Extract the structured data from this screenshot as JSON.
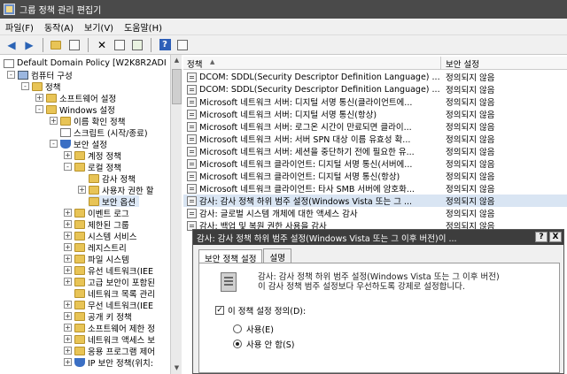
{
  "window": {
    "title": "그룹 정책 관리 편집기"
  },
  "menu": [
    "파일(F)",
    "동작(A)",
    "보기(V)",
    "도움말(H)"
  ],
  "tree": {
    "items": [
      {
        "label": "Default Domain Policy [W2K8R2ADI",
        "icon": "policy-icon",
        "expander": ""
      },
      {
        "label": "컴퓨터 구성",
        "icon": "computer-icon",
        "expander": "-"
      },
      {
        "label": "정책",
        "icon": "folder-icon",
        "expander": "-"
      },
      {
        "label": "소프트웨어 설정",
        "icon": "folder-icon",
        "expander": "+"
      },
      {
        "label": "Windows 설정",
        "icon": "folder-icon",
        "expander": "-"
      },
      {
        "label": "이름 확인 정책",
        "icon": "folder-icon",
        "expander": "+"
      },
      {
        "label": "스크립트 (시작/종료)",
        "icon": "script-icon",
        "expander": ""
      },
      {
        "label": "보안 설정",
        "icon": "shield-icon",
        "expander": "-"
      },
      {
        "label": "계정 정책",
        "icon": "folder-icon",
        "expander": "+"
      },
      {
        "label": "로컬 정책",
        "icon": "folder-icon",
        "expander": "-"
      },
      {
        "label": "감사 정책",
        "icon": "folder-icon",
        "expander": ""
      },
      {
        "label": "사용자 권한 할",
        "icon": "folder-icon",
        "expander": "+"
      },
      {
        "label": "보안 옵션",
        "icon": "folder-icon",
        "expander": ""
      },
      {
        "label": "이벤트 로그",
        "icon": "folder-icon",
        "expander": "+"
      },
      {
        "label": "제한된 그룹",
        "icon": "folder-icon",
        "expander": "+"
      },
      {
        "label": "시스템 서비스",
        "icon": "folder-icon",
        "expander": "+"
      },
      {
        "label": "레지스트리",
        "icon": "folder-icon",
        "expander": "+"
      },
      {
        "label": "파일 시스템",
        "icon": "folder-icon",
        "expander": "+"
      },
      {
        "label": "유선 네트워크(IEE",
        "icon": "folder-icon",
        "expander": "+"
      },
      {
        "label": "고급 보안이 포함된",
        "icon": "folder-icon",
        "expander": "+"
      },
      {
        "label": "네트워크 목록 관리",
        "icon": "folder-icon",
        "expander": ""
      },
      {
        "label": "무선 네트워크(IEE",
        "icon": "folder-icon",
        "expander": "+"
      },
      {
        "label": "공개 키 정책",
        "icon": "folder-icon",
        "expander": "+"
      },
      {
        "label": "소프트웨어 제한 정",
        "icon": "folder-icon",
        "expander": "+"
      },
      {
        "label": "네트워크 액세스 보",
        "icon": "folder-icon",
        "expander": "+"
      },
      {
        "label": "응용 프로그램 제어",
        "icon": "folder-icon",
        "expander": "+"
      },
      {
        "label": "IP 보안 정책(위치:",
        "icon": "shield-icon",
        "expander": "+"
      }
    ]
  },
  "list": {
    "col_policy": "정책",
    "col_setting": "보안 설정",
    "rows": [
      {
        "name": "DCOM: SDDL(Security Descriptor Definition Language) ...",
        "setting": "정의되지 않음"
      },
      {
        "name": "DCOM: SDDL(Security Descriptor Definition Language) ...",
        "setting": "정의되지 않음"
      },
      {
        "name": "Microsoft 네트워크 서버: 디지털 서명 통신(클라이언트에...",
        "setting": "정의되지 않음"
      },
      {
        "name": "Microsoft 네트워크 서버: 디지털 서명 통신(항상)",
        "setting": "정의되지 않음"
      },
      {
        "name": "Microsoft 네트워크 서버: 로그온 시간이 만료되면 클라이...",
        "setting": "정의되지 않음"
      },
      {
        "name": "Microsoft 네트워크 서버: 서버 SPN 대상 이름 유효성 확...",
        "setting": "정의되지 않음"
      },
      {
        "name": "Microsoft 네트워크 서버: 세션을 중단하기 전에 필요한 유...",
        "setting": "정의되지 않음"
      },
      {
        "name": "Microsoft 네트워크 클라이언트: 디지털 서명 통신(서버에...",
        "setting": "정의되지 않음"
      },
      {
        "name": "Microsoft 네트워크 클라이언트: 디지털 서명 통신(항상)",
        "setting": "정의되지 않음"
      },
      {
        "name": "Microsoft 네트워크 클라이언트: 타사 SMB 서버에 암호화...",
        "setting": "정의되지 않음"
      },
      {
        "name": "감사: 감사 정책 하위 범주 설정(Windows Vista 또는 그 ...",
        "setting": "정의되지 않음"
      },
      {
        "name": "감사: 글로벌 시스템 개체에 대한 액세스 감사",
        "setting": "정의되지 않음"
      },
      {
        "name": "감사: 백업 및 복원 권한 사용을 감사",
        "setting": "정의되지 않음"
      }
    ]
  },
  "dialog": {
    "title": "감사: 감사 정책 하위 범주 설정(Windows Vista 또는 그 이후 버전)이 ...",
    "help_btn": "?",
    "close_btn": "X",
    "tab_security": "보안 정책 설정",
    "tab_explain": "설명",
    "desc_line1": "감사: 감사 정책 하위 범주 설정(Windows Vista 또는 그 이후 버전)",
    "desc_line2": "이 감사 정책 범주 설정보다 우선하도록 강제로 설정합니다.",
    "define_label": "이 정책 설정 정의(D):",
    "enable_label": "사용(E)",
    "disable_label": "사용 안 함(S)"
  }
}
